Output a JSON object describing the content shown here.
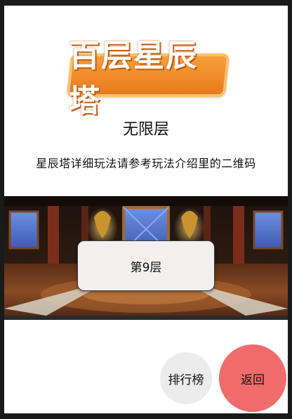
{
  "logo": {
    "text": "百层星辰塔",
    "colors": {
      "plate": "#f08a2a",
      "text": "#ffffff"
    }
  },
  "mode_title": "无限层",
  "description": "星辰塔详细玩法请参考玩法介绍里的二维码",
  "scene": {
    "floor_button_label": "第9层"
  },
  "actions": {
    "rank_label": "排行榜",
    "back_label": "返回"
  },
  "colors": {
    "back_button": "#ef6c6b",
    "rank_button": "#ececec"
  }
}
